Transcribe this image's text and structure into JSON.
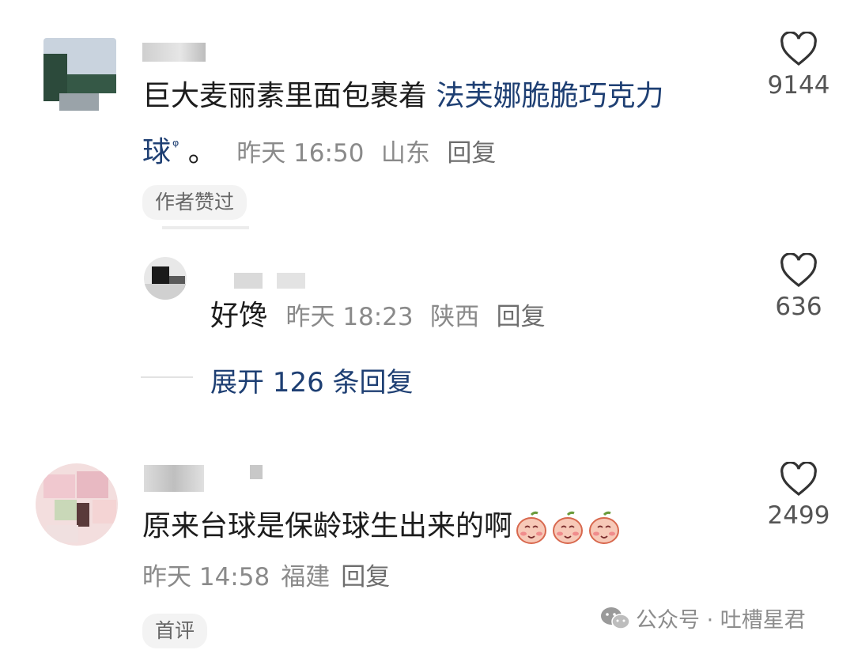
{
  "colors": {
    "link": "#1e3f73",
    "meta": "#8a8a8a",
    "badge_bg": "#f3f3f3"
  },
  "comments": [
    {
      "text_plain": "巨大麦丽素里面包裹着 ",
      "text_link_a": "法芙娜脆脆巧克力",
      "text_link_b": "球",
      "text_tail": " 。",
      "time": "昨天 16:50",
      "location": "山东",
      "reply": "回复",
      "likes": "9144",
      "badge": "作者赞过",
      "replies": [
        {
          "text": "好馋",
          "time": "昨天 18:23",
          "location": "陕西",
          "reply": "回复",
          "likes": "636"
        }
      ],
      "expand": "展开 126 条回复"
    },
    {
      "text": "原来台球是保龄球生出来的啊",
      "emojis": [
        "peach-face-emoji",
        "peach-face-emoji",
        "peach-face-emoji"
      ],
      "time": "昨天 14:58",
      "location": "福建",
      "reply": "回复",
      "likes": "2499",
      "badge": "首评"
    }
  ],
  "watermark": {
    "prefix": "公众号 ·",
    "name": "吐槽星君"
  }
}
